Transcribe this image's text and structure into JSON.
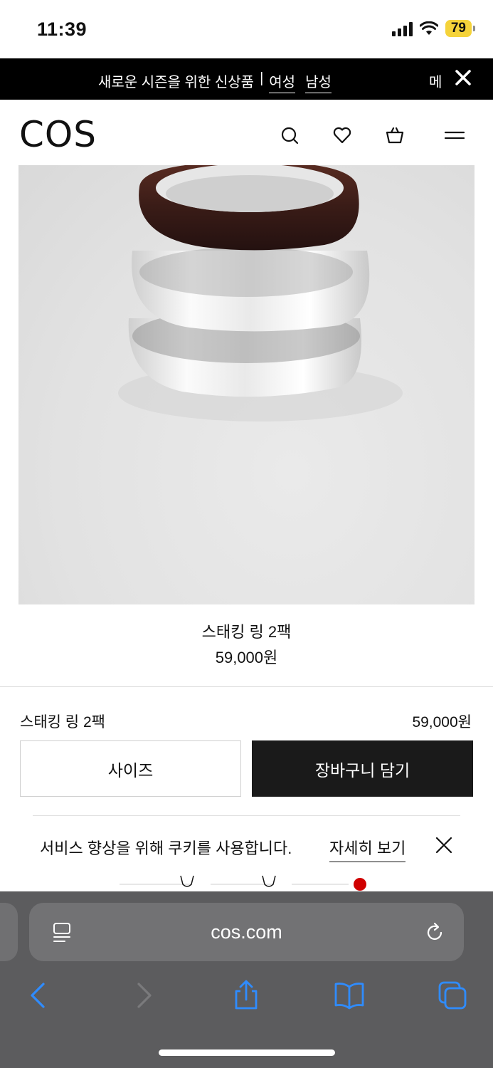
{
  "status_bar": {
    "time": "11:39",
    "battery": "79"
  },
  "promo_banner": {
    "text": "새로운 시즌을 위한 신상품",
    "separator": "|",
    "link_women": "여성",
    "link_men": "남성",
    "menu_label": "메"
  },
  "header": {
    "logo": "COS"
  },
  "product": {
    "name": "스태킹 링 2팩",
    "price": "59,000원"
  },
  "purchase_bar": {
    "name": "스태킹 링 2팩",
    "price": "59,000원",
    "size_label": "사이즈",
    "add_to_cart_label": "장바구니 담기"
  },
  "cookie_notice": {
    "text": "서비스 향상을 위해 쿠키를 사용합니다.",
    "link": "자세히 보기"
  },
  "browser": {
    "url": "cos.com"
  },
  "colors": {
    "accent_blue": "#2f8cff",
    "banner_bg": "#000000",
    "cart_button_bg": "#1a1a1a",
    "battery": "#f5d33a",
    "swatch_red": "#d00000"
  },
  "icons": [
    "search-icon",
    "heart-icon",
    "basket-icon",
    "menu-icon",
    "close-icon",
    "reader-icon",
    "reload-icon",
    "back-icon",
    "forward-icon",
    "share-icon",
    "bookmarks-icon",
    "tabs-icon"
  ]
}
